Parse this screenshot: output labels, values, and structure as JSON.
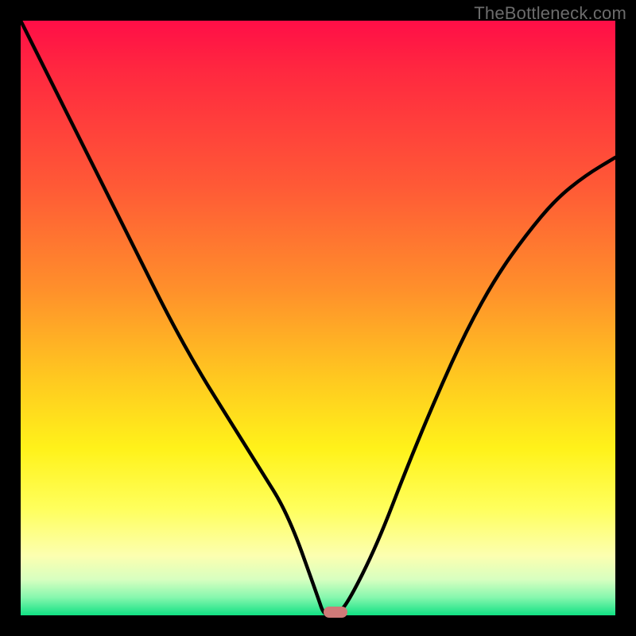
{
  "watermark": "TheBottleneck.com",
  "chart_data": {
    "type": "line",
    "title": "",
    "xlabel": "",
    "ylabel": "",
    "xlim": [
      0,
      1
    ],
    "ylim": [
      0,
      1
    ],
    "grid": false,
    "legend": false,
    "x": [
      0.0,
      0.05,
      0.1,
      0.15,
      0.2,
      0.25,
      0.3,
      0.35,
      0.4,
      0.45,
      0.5,
      0.51,
      0.53,
      0.55,
      0.6,
      0.65,
      0.7,
      0.75,
      0.8,
      0.85,
      0.9,
      0.95,
      1.0
    ],
    "y": [
      1.0,
      0.9,
      0.8,
      0.7,
      0.6,
      0.5,
      0.41,
      0.33,
      0.25,
      0.17,
      0.03,
      0.0,
      0.0,
      0.02,
      0.12,
      0.25,
      0.37,
      0.48,
      0.57,
      0.64,
      0.7,
      0.74,
      0.77
    ],
    "marker": {
      "x": 0.53,
      "y": 0.0
    },
    "background_gradient": {
      "stops": [
        {
          "pos": 0.0,
          "color": "#ff0e47"
        },
        {
          "pos": 0.28,
          "color": "#ff5a36"
        },
        {
          "pos": 0.6,
          "color": "#ffc820"
        },
        {
          "pos": 0.82,
          "color": "#ffff5c"
        },
        {
          "pos": 0.94,
          "color": "#d7ffc0"
        },
        {
          "pos": 1.0,
          "color": "#11e183"
        }
      ]
    }
  }
}
